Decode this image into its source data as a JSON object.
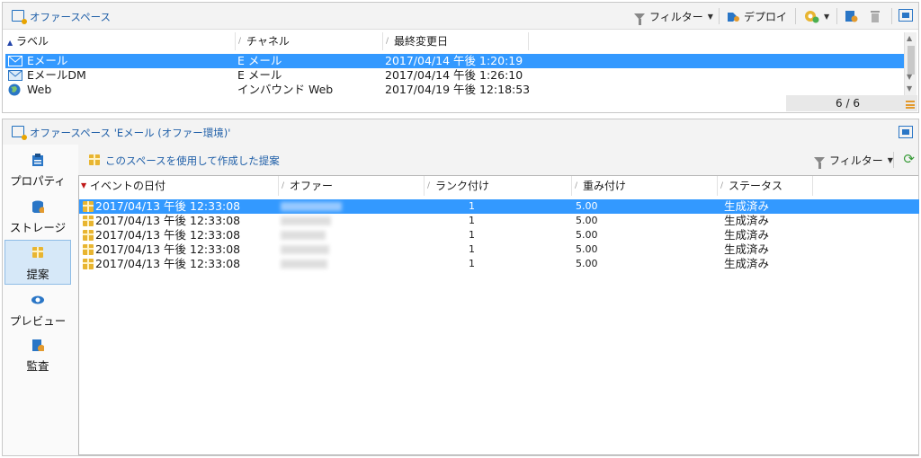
{
  "top_panel": {
    "title": "オファースペース",
    "toolbar": {
      "filter_label": "フィルター",
      "deploy_label": "デプロイ"
    },
    "columns": [
      "ラベル",
      "チャネル",
      "最終変更日"
    ],
    "rows": [
      {
        "label": "Eメール",
        "channel": "E メール",
        "modified": "2017/04/14 午後 1:20:19",
        "selected": true
      },
      {
        "label": "EメールDM",
        "channel": "E メール",
        "modified": "2017/04/14 午後 1:26:10",
        "selected": false
      },
      {
        "label": "Web",
        "channel": "インバウンド Web",
        "modified": "2017/04/19 午後 12:18:53",
        "selected": false
      }
    ],
    "count": "6 / 6"
  },
  "bottom_panel": {
    "title": "オファースペース 'Eメール (オファー環境)'",
    "sidebar": {
      "items": [
        {
          "label": "プロパティ",
          "icon": "clipboard-icon"
        },
        {
          "label": "ストレージ",
          "icon": "database-icon"
        },
        {
          "label": "提案",
          "icon": "gift-icon",
          "active": true
        },
        {
          "label": "プレビュー",
          "icon": "eye-icon"
        },
        {
          "label": "監査",
          "icon": "audit-icon"
        }
      ]
    },
    "content_title": "このスペースを使用して作成した提案",
    "filter_label": "フィルター",
    "columns": [
      "イベントの日付",
      "オファー",
      "ランク付け",
      "重み付け",
      "ステータス"
    ],
    "rows": [
      {
        "date": "2017/04/13 午後 12:33:08",
        "rank": "1",
        "weight": "5.00",
        "status": "生成済み",
        "selected": true
      },
      {
        "date": "2017/04/13 午後 12:33:08",
        "rank": "1",
        "weight": "5.00",
        "status": "生成済み",
        "selected": false
      },
      {
        "date": "2017/04/13 午後 12:33:08",
        "rank": "1",
        "weight": "5.00",
        "status": "生成済み",
        "selected": false
      },
      {
        "date": "2017/04/13 午後 12:33:08",
        "rank": "1",
        "weight": "5.00",
        "status": "生成済み",
        "selected": false
      },
      {
        "date": "2017/04/13 午後 12:33:08",
        "rank": "1",
        "weight": "5.00",
        "status": "生成済み",
        "selected": false
      }
    ]
  },
  "colors": {
    "selection": "#3399ff",
    "title_blue": "#1f5fa8",
    "accent_orange": "#e39a2e",
    "refresh_green": "#3a9c3a"
  }
}
